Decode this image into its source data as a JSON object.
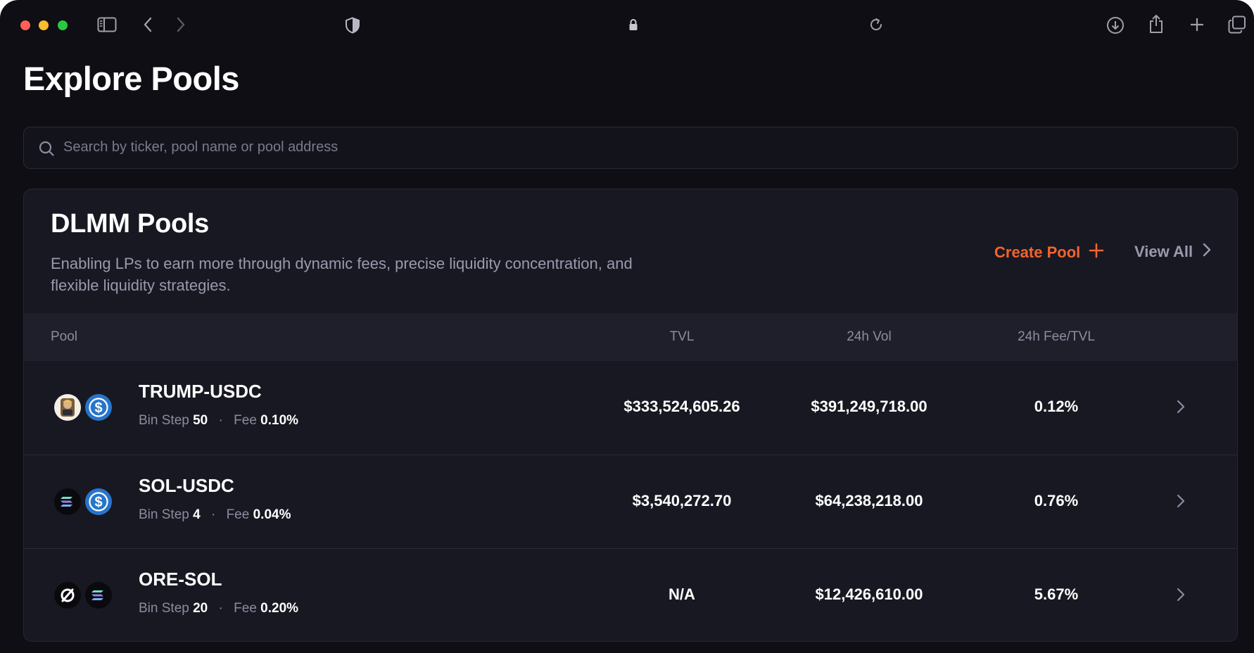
{
  "browser": {
    "icons": [
      "sidebar-icon",
      "back-icon",
      "forward-icon",
      "shield-icon",
      "lock-icon",
      "reload-icon",
      "download-icon",
      "share-icon",
      "new-tab-icon",
      "tabs-overview-icon"
    ]
  },
  "page": {
    "title": "Explore Pools"
  },
  "search": {
    "placeholder": "Search by ticker, pool name or pool address",
    "value": ""
  },
  "dlmm": {
    "title": "DLMM Pools",
    "description": "Enabling LPs to earn more through dynamic fees, precise liquidity concentration, and flexible liquidity strategies.",
    "create_pool_label": "Create Pool",
    "view_all_label": "View All",
    "accent_color": "#f2642d",
    "columns": {
      "pool": "Pool",
      "tvl": "TVL",
      "vol": "24h Vol",
      "fee_tvl": "24h Fee/TVL"
    },
    "rows": [
      {
        "name": "TRUMP-USDC",
        "tokens": [
          "trump-token-icon",
          "usdc-token-icon"
        ],
        "bin_step_label": "Bin Step",
        "bin_step": "50",
        "fee_label": "Fee",
        "fee": "0.10%",
        "tvl": "$333,524,605.26",
        "vol": "$391,249,718.00",
        "fee_tvl": "0.12%"
      },
      {
        "name": "SOL-USDC",
        "tokens": [
          "sol-token-icon",
          "usdc-token-icon"
        ],
        "bin_step_label": "Bin Step",
        "bin_step": "4",
        "fee_label": "Fee",
        "fee": "0.04%",
        "tvl": "$3,540,272.70",
        "vol": "$64,238,218.00",
        "fee_tvl": "0.76%"
      },
      {
        "name": "ORE-SOL",
        "tokens": [
          "ore-token-icon",
          "sol-token-icon"
        ],
        "bin_step_label": "Bin Step",
        "bin_step": "20",
        "fee_label": "Fee",
        "fee": "0.20%",
        "tvl": "N/A",
        "vol": "$12,426,610.00",
        "fee_tvl": "5.67%"
      }
    ]
  }
}
